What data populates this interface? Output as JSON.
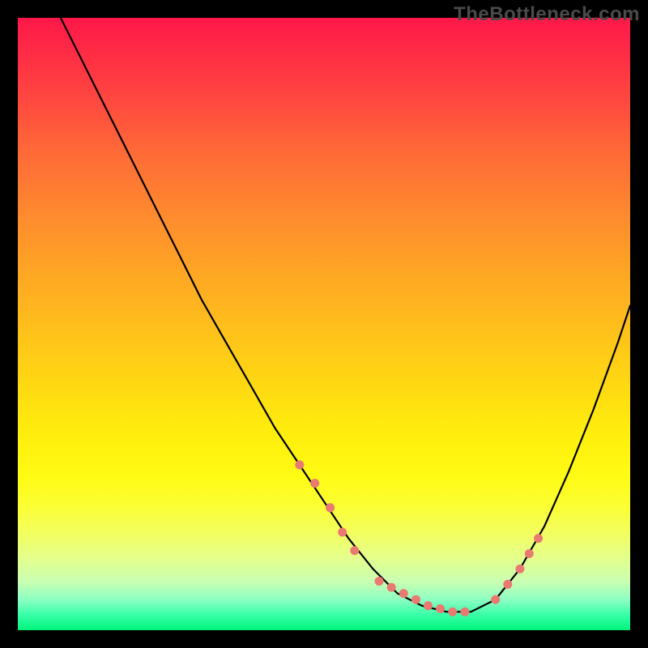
{
  "watermark": "TheBottleneck.com",
  "chart_data": {
    "type": "line",
    "title": "",
    "xlabel": "",
    "ylabel": "",
    "xlim": [
      0,
      100
    ],
    "ylim": [
      0,
      100
    ],
    "grid": false,
    "legend": false,
    "series": [
      {
        "name": "main-curve",
        "color": "#000000",
        "stroke_width": 2,
        "x": [
          7,
          10,
          14,
          18,
          22,
          26,
          30,
          34,
          38,
          42,
          46,
          50,
          54,
          58,
          60,
          62,
          64,
          66,
          70,
          74,
          78,
          82,
          86,
          90,
          94,
          98,
          100
        ],
        "values": [
          100,
          94,
          86,
          78,
          70,
          62,
          54,
          47,
          40,
          33,
          27,
          21,
          15,
          10,
          8,
          6,
          5,
          4,
          3,
          3,
          5,
          10,
          17,
          26,
          36,
          47,
          53
        ]
      },
      {
        "name": "highlight-dots-left",
        "type": "scatter",
        "color": "#e97a72",
        "marker_size": 10,
        "x": [
          46,
          48.5,
          51,
          53,
          55
        ],
        "values": [
          27,
          24,
          20,
          16,
          13
        ]
      },
      {
        "name": "highlight-dots-bottom",
        "type": "scatter",
        "color": "#e97a72",
        "marker_size": 10,
        "x": [
          59,
          61,
          63,
          65,
          67,
          69,
          71,
          73
        ],
        "values": [
          8,
          7,
          6,
          5,
          4,
          3.5,
          3,
          3
        ]
      },
      {
        "name": "highlight-dots-right",
        "type": "scatter",
        "color": "#e97a72",
        "marker_size": 10,
        "x": [
          78,
          80,
          82,
          83.5,
          85
        ],
        "values": [
          5,
          7.5,
          10,
          12.5,
          15
        ]
      }
    ],
    "background_gradient": {
      "direction": "vertical",
      "stops": [
        {
          "pos": 0.0,
          "color": "#ff184a"
        },
        {
          "pos": 0.5,
          "color": "#ffc31a"
        },
        {
          "pos": 0.8,
          "color": "#fbff36"
        },
        {
          "pos": 1.0,
          "color": "#00f37a"
        }
      ]
    }
  }
}
